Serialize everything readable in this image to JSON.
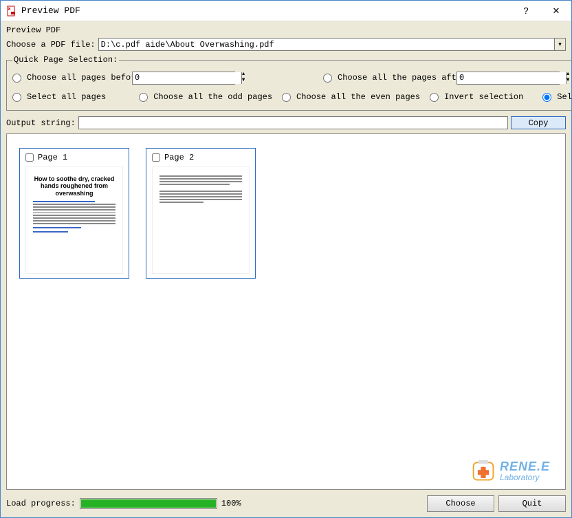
{
  "window": {
    "title": "Preview PDF",
    "help": "?",
    "close": "✕"
  },
  "subtitle": "Preview PDF",
  "file_row": {
    "label": "Choose a PDF file:",
    "value": "D:\\c.pdf aide\\About Overwashing.pdf"
  },
  "qps": {
    "legend": "Quick Page Selection:",
    "opt_before": "Choose all pages before",
    "spin_before": "0",
    "opt_after": "Choose all the pages after",
    "spin_after": "0",
    "opt_all": "Select all pages",
    "opt_odd": "Choose all the odd pages",
    "opt_even": "Choose all the even pages",
    "opt_invert": "Invert selection",
    "opt_nothing": "Select nothing",
    "selected": "opt_nothing"
  },
  "output": {
    "label": "Output string:",
    "value": "",
    "copy": "Copy"
  },
  "pages": [
    {
      "label": "Page 1",
      "checked": false,
      "doc_title": "How to soothe dry, cracked hands roughened from overwashing"
    },
    {
      "label": "Page 2",
      "checked": false
    }
  ],
  "brand": {
    "name": "RENE.E",
    "sub": "Laboratory"
  },
  "progress": {
    "label": "Load progress:",
    "percent": 100,
    "percent_text": "100%"
  },
  "buttons": {
    "choose": "Choose",
    "quit": "Quit"
  }
}
